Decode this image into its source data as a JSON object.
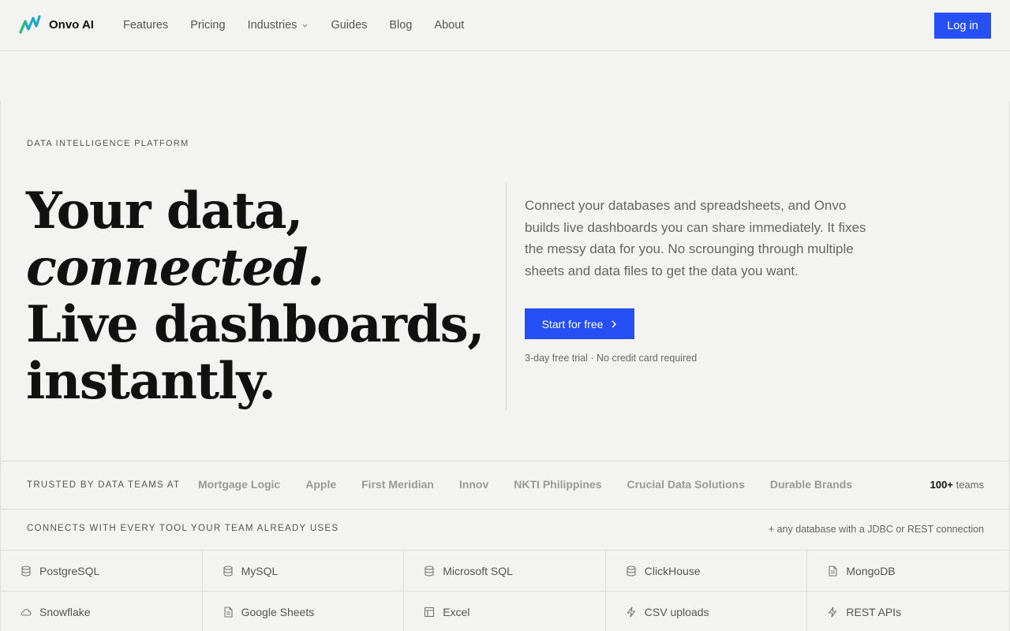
{
  "nav": {
    "brand": "Onvo AI",
    "links": [
      "Features",
      "Pricing",
      "Industries",
      "Guides",
      "Blog",
      "About"
    ],
    "login": "Log in"
  },
  "hero": {
    "eyebrow": "DATA INTELLIGENCE PLATFORM",
    "headline_1": "Your data,",
    "headline_2": "connected.",
    "headline_3": "Live dashboards,",
    "headline_4": "instantly.",
    "lede": "Connect your databases and spreadsheets, and Onvo builds live dashboards you can share immediately. It fixes the messy data for you. No scrounging through multiple sheets and data files to get the data you want.",
    "cta": "Start for free",
    "fineprint": "3-day free trial · No credit card required"
  },
  "trusted": {
    "label": "TRUSTED BY DATA TEAMS AT",
    "logos": [
      "Mortgage Logic",
      "Apple",
      "First Meridian",
      "Innov",
      "NKTI Philippines",
      "Crucial Data Solutions",
      "Durable Brands"
    ],
    "teams_count": "100+",
    "teams_suffix": "teams"
  },
  "connects": {
    "label": "CONNECTS WITH EVERY TOOL YOUR TEAM ALREADY USES",
    "note": "+ any database with a JDBC or REST connection",
    "items": [
      {
        "label": "PostgreSQL",
        "icon": "database-icon"
      },
      {
        "label": "MySQL",
        "icon": "database-icon"
      },
      {
        "label": "Microsoft SQL",
        "icon": "database-icon"
      },
      {
        "label": "ClickHouse",
        "icon": "database-icon"
      },
      {
        "label": "MongoDB",
        "icon": "file-icon"
      },
      {
        "label": "Snowflake",
        "icon": "cloud-icon"
      },
      {
        "label": "Google Sheets",
        "icon": "file-icon"
      },
      {
        "label": "Excel",
        "icon": "table-icon"
      },
      {
        "label": "CSV uploads",
        "icon": "bolt-icon"
      },
      {
        "label": "REST APIs",
        "icon": "bolt-icon"
      }
    ]
  },
  "colors": {
    "accent": "#2650f5",
    "background": "#f3f3f1"
  }
}
